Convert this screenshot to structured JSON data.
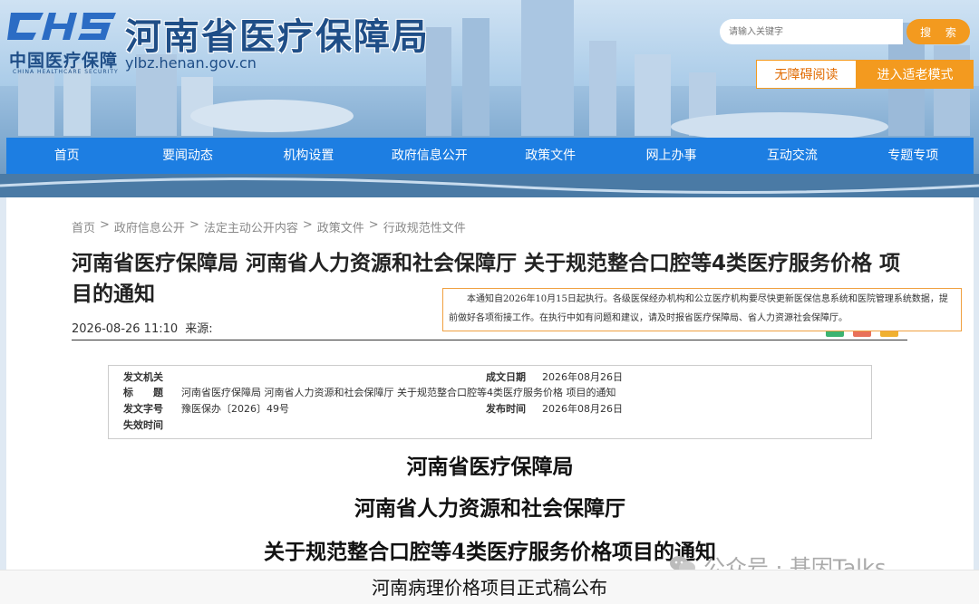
{
  "header": {
    "logo_mark": "CHS",
    "logo_cn": "中国医疗保障",
    "logo_en": "CHINA HEALTHCARE SECURITY",
    "site_title": "河南省医疗保障局",
    "domain": "ylbz.henan.gov.cn",
    "search_placeholder": "请输入关键字",
    "search_button": "搜 索",
    "accessible_button": "无障碍阅读",
    "elder_button": "进入适老模式"
  },
  "nav": {
    "items": [
      "首页",
      "要闻动态",
      "机构设置",
      "政府信息公开",
      "政策文件",
      "网上办事",
      "互动交流",
      "专题专项"
    ]
  },
  "breadcrumb": [
    "首页",
    "政府信息公开",
    "法定主动公开内容",
    "政策文件",
    "行政规范性文件"
  ],
  "breadcrumb_sep": ">",
  "article": {
    "title": "河南省医疗保障局 河南省人力资源和社会保障厅 关于规范整合口腔等4类医疗服务价格 项目的通知",
    "date": "2026-08-26 11:10",
    "source_label": "来源:"
  },
  "info_table": {
    "issuer_label": "发文机关",
    "issuer_value": "",
    "formed_date_label": "成文日期",
    "formed_date_value": "2026年08月26日",
    "title_label": "标　　题",
    "title_value": "河南省医疗保障局 河南省人力资源和社会保障厅 关于规范整合口腔等4类医疗服务价格 项目的通知",
    "doc_no_label": "发文字号",
    "doc_no_value": "豫医保办〔2026〕49号",
    "publish_label": "发布时间",
    "publish_value": "2026年08月26日",
    "expiry_label": "失效时间"
  },
  "body": {
    "line1": "河南省医疗保障局",
    "line2": "河南省人力资源和社会保障厅",
    "line3": "关于规范整合口腔等4类医疗服务价格项目的通知"
  },
  "note": "本通知自2026年10月15日起执行。各级医保经办机构和公立医疗机构要尽快更新医保信息系统和医院管理系统数据，提前做好各项衔接工作。在执行中如有问题和建议，请及时报省医疗保障局、省人力资源社会保障厅。",
  "watermark": "公众号 · 基因Talks",
  "caption": "河南病理价格项目正式稿公布",
  "colors": {
    "nav_blue": "#1d7ee2",
    "accent_orange": "#f39a1f",
    "title_blue": "#1f4e87"
  }
}
